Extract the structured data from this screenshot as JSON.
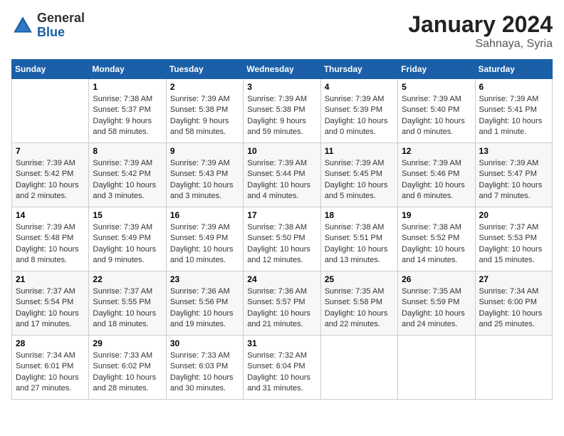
{
  "header": {
    "logo_general": "General",
    "logo_blue": "Blue",
    "month_title": "January 2024",
    "location": "Sahnaya, Syria"
  },
  "weekdays": [
    "Sunday",
    "Monday",
    "Tuesday",
    "Wednesday",
    "Thursday",
    "Friday",
    "Saturday"
  ],
  "weeks": [
    [
      {
        "day": "",
        "info": ""
      },
      {
        "day": "1",
        "info": "Sunrise: 7:38 AM\nSunset: 5:37 PM\nDaylight: 9 hours\nand 58 minutes."
      },
      {
        "day": "2",
        "info": "Sunrise: 7:39 AM\nSunset: 5:38 PM\nDaylight: 9 hours\nand 58 minutes."
      },
      {
        "day": "3",
        "info": "Sunrise: 7:39 AM\nSunset: 5:38 PM\nDaylight: 9 hours\nand 59 minutes."
      },
      {
        "day": "4",
        "info": "Sunrise: 7:39 AM\nSunset: 5:39 PM\nDaylight: 10 hours\nand 0 minutes."
      },
      {
        "day": "5",
        "info": "Sunrise: 7:39 AM\nSunset: 5:40 PM\nDaylight: 10 hours\nand 0 minutes."
      },
      {
        "day": "6",
        "info": "Sunrise: 7:39 AM\nSunset: 5:41 PM\nDaylight: 10 hours\nand 1 minute."
      }
    ],
    [
      {
        "day": "7",
        "info": "Sunrise: 7:39 AM\nSunset: 5:42 PM\nDaylight: 10 hours\nand 2 minutes."
      },
      {
        "day": "8",
        "info": "Sunrise: 7:39 AM\nSunset: 5:42 PM\nDaylight: 10 hours\nand 3 minutes."
      },
      {
        "day": "9",
        "info": "Sunrise: 7:39 AM\nSunset: 5:43 PM\nDaylight: 10 hours\nand 3 minutes."
      },
      {
        "day": "10",
        "info": "Sunrise: 7:39 AM\nSunset: 5:44 PM\nDaylight: 10 hours\nand 4 minutes."
      },
      {
        "day": "11",
        "info": "Sunrise: 7:39 AM\nSunset: 5:45 PM\nDaylight: 10 hours\nand 5 minutes."
      },
      {
        "day": "12",
        "info": "Sunrise: 7:39 AM\nSunset: 5:46 PM\nDaylight: 10 hours\nand 6 minutes."
      },
      {
        "day": "13",
        "info": "Sunrise: 7:39 AM\nSunset: 5:47 PM\nDaylight: 10 hours\nand 7 minutes."
      }
    ],
    [
      {
        "day": "14",
        "info": "Sunrise: 7:39 AM\nSunset: 5:48 PM\nDaylight: 10 hours\nand 8 minutes."
      },
      {
        "day": "15",
        "info": "Sunrise: 7:39 AM\nSunset: 5:49 PM\nDaylight: 10 hours\nand 9 minutes."
      },
      {
        "day": "16",
        "info": "Sunrise: 7:39 AM\nSunset: 5:49 PM\nDaylight: 10 hours\nand 10 minutes."
      },
      {
        "day": "17",
        "info": "Sunrise: 7:38 AM\nSunset: 5:50 PM\nDaylight: 10 hours\nand 12 minutes."
      },
      {
        "day": "18",
        "info": "Sunrise: 7:38 AM\nSunset: 5:51 PM\nDaylight: 10 hours\nand 13 minutes."
      },
      {
        "day": "19",
        "info": "Sunrise: 7:38 AM\nSunset: 5:52 PM\nDaylight: 10 hours\nand 14 minutes."
      },
      {
        "day": "20",
        "info": "Sunrise: 7:37 AM\nSunset: 5:53 PM\nDaylight: 10 hours\nand 15 minutes."
      }
    ],
    [
      {
        "day": "21",
        "info": "Sunrise: 7:37 AM\nSunset: 5:54 PM\nDaylight: 10 hours\nand 17 minutes."
      },
      {
        "day": "22",
        "info": "Sunrise: 7:37 AM\nSunset: 5:55 PM\nDaylight: 10 hours\nand 18 minutes."
      },
      {
        "day": "23",
        "info": "Sunrise: 7:36 AM\nSunset: 5:56 PM\nDaylight: 10 hours\nand 19 minutes."
      },
      {
        "day": "24",
        "info": "Sunrise: 7:36 AM\nSunset: 5:57 PM\nDaylight: 10 hours\nand 21 minutes."
      },
      {
        "day": "25",
        "info": "Sunrise: 7:35 AM\nSunset: 5:58 PM\nDaylight: 10 hours\nand 22 minutes."
      },
      {
        "day": "26",
        "info": "Sunrise: 7:35 AM\nSunset: 5:59 PM\nDaylight: 10 hours\nand 24 minutes."
      },
      {
        "day": "27",
        "info": "Sunrise: 7:34 AM\nSunset: 6:00 PM\nDaylight: 10 hours\nand 25 minutes."
      }
    ],
    [
      {
        "day": "28",
        "info": "Sunrise: 7:34 AM\nSunset: 6:01 PM\nDaylight: 10 hours\nand 27 minutes."
      },
      {
        "day": "29",
        "info": "Sunrise: 7:33 AM\nSunset: 6:02 PM\nDaylight: 10 hours\nand 28 minutes."
      },
      {
        "day": "30",
        "info": "Sunrise: 7:33 AM\nSunset: 6:03 PM\nDaylight: 10 hours\nand 30 minutes."
      },
      {
        "day": "31",
        "info": "Sunrise: 7:32 AM\nSunset: 6:04 PM\nDaylight: 10 hours\nand 31 minutes."
      },
      {
        "day": "",
        "info": ""
      },
      {
        "day": "",
        "info": ""
      },
      {
        "day": "",
        "info": ""
      }
    ]
  ]
}
